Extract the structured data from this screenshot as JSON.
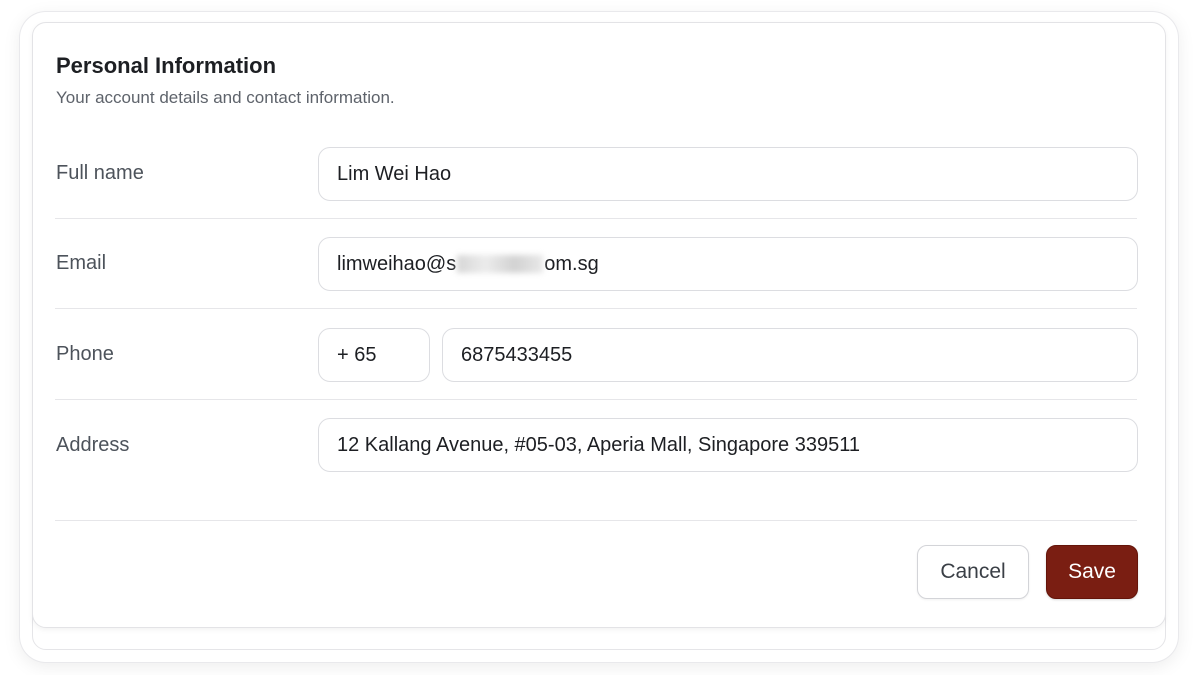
{
  "section": {
    "title": "Personal Information",
    "subtitle": "Your account details and contact information."
  },
  "fields": {
    "full_name": {
      "label": "Full name",
      "value": "Lim Wei Hao"
    },
    "email": {
      "label": "Email",
      "value_prefix": "limweihao@s",
      "value_suffix": "om.sg",
      "redacted": true
    },
    "phone": {
      "label": "Phone",
      "country_code": "+ 65",
      "number": "6875433455"
    },
    "address": {
      "label": "Address",
      "value": "12 Kallang Avenue, #05-03, Aperia Mall, Singapore 339511"
    }
  },
  "actions": {
    "cancel_label": "Cancel",
    "save_label": "Save"
  },
  "colors": {
    "primary_button": "#7a1e12",
    "border": "#dcdde1",
    "label_text": "#4d535b"
  }
}
